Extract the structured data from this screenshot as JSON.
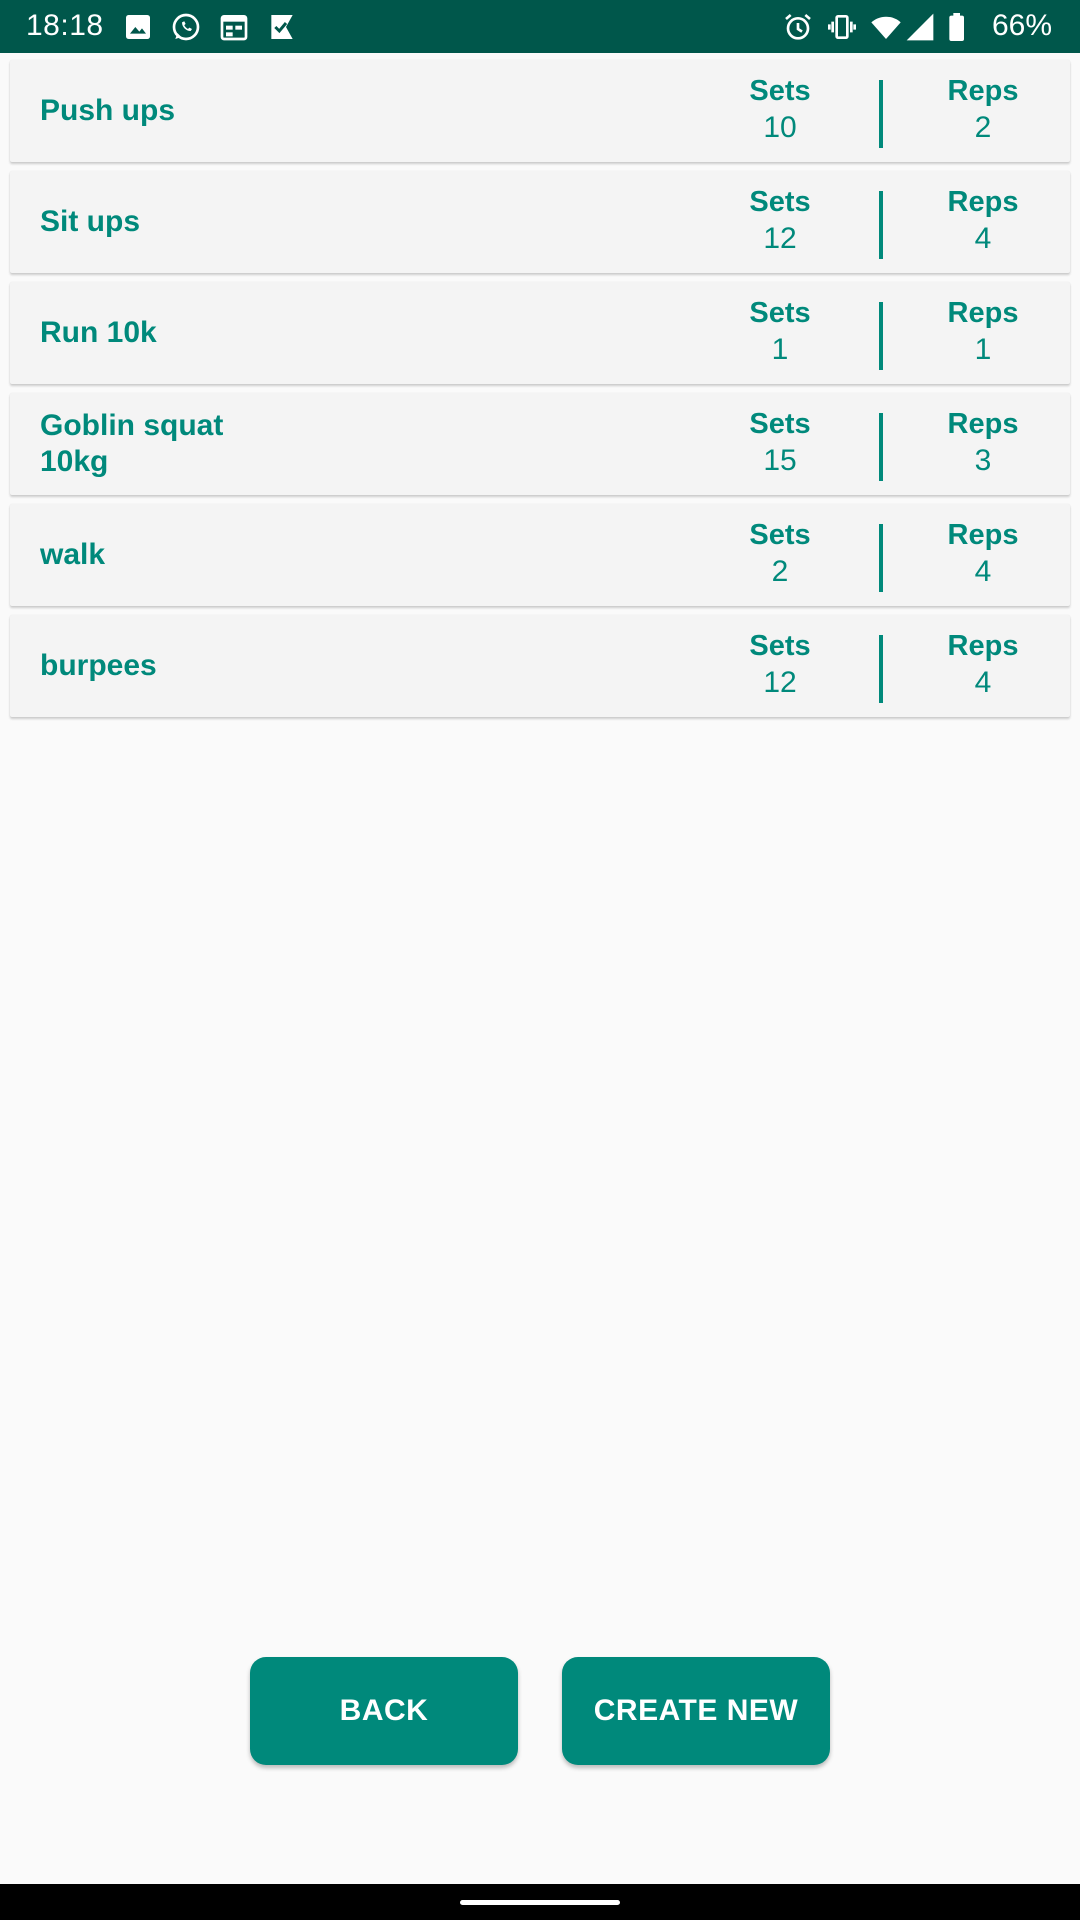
{
  "status_bar": {
    "time": "18:18",
    "battery": "66%",
    "left_icons": [
      "gallery-icon",
      "whatsapp-icon",
      "calendar-icon",
      "tasks-icon"
    ],
    "right_icons": [
      "alarm-icon",
      "vibrate-icon",
      "wifi-icon",
      "signal-icon",
      "battery-icon"
    ],
    "background": "#00574b"
  },
  "exercises": [
    {
      "name": "Push ups",
      "sets_label": "Sets",
      "sets": "10",
      "reps_label": "Reps",
      "reps": "2"
    },
    {
      "name": "Sit ups",
      "sets_label": "Sets",
      "sets": "12",
      "reps_label": "Reps",
      "reps": "4"
    },
    {
      "name": "Run 10k",
      "sets_label": "Sets",
      "sets": "1",
      "reps_label": "Reps",
      "reps": "1"
    },
    {
      "name": "Goblin squat\n10kg",
      "sets_label": "Sets",
      "sets": "15",
      "reps_label": "Reps",
      "reps": "3"
    },
    {
      "name": "walk",
      "sets_label": "Sets",
      "sets": "2",
      "reps_label": "Reps",
      "reps": "4"
    },
    {
      "name": "burpees",
      "sets_label": "Sets",
      "sets": "12",
      "reps_label": "Reps",
      "reps": "4"
    }
  ],
  "buttons": {
    "back_label": "BACK",
    "create_label": "CREATE NEW"
  },
  "colors": {
    "accent": "#00897b",
    "card": "#f4f4f4",
    "page": "#fafafa"
  }
}
